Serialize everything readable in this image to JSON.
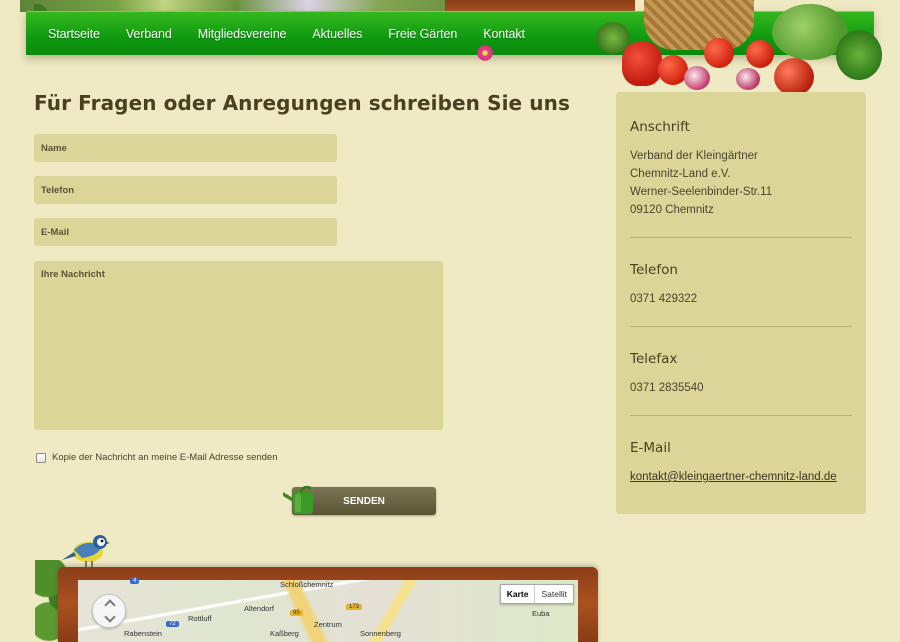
{
  "nav": {
    "items": [
      "Startseite",
      "Verband",
      "Mitgliedsvereine",
      "Aktuelles",
      "Freie Gärten",
      "Kontakt"
    ]
  },
  "form": {
    "heading": "Für Fragen oder Anregungen schreiben Sie uns",
    "name_placeholder": "Name",
    "phone_placeholder": "Telefon",
    "email_placeholder": "E-Mail",
    "message_placeholder": "Ihre Nachricht",
    "copy_label": "Kopie der Nachricht an meine E-Mail Adresse senden",
    "copy_checked": false,
    "send_label": "SENDEN"
  },
  "sidebar": {
    "address_title": "Anschrift",
    "address_lines": [
      "Verband der Kleingärtner",
      "Chemnitz-Land e.V.",
      "Werner-Seelenbinder-Str.11",
      "09120 Chemnitz"
    ],
    "phone_title": "Telefon",
    "phone": "0371 429322",
    "fax_title": "Telefax",
    "fax": "0371 2835540",
    "email_title": "E-Mail",
    "email": "kontakt@kleingaertner-chemnitz-land.de"
  },
  "map": {
    "type_map": "Karte",
    "type_satellite": "Satellit",
    "labels": [
      "Schloßchemnitz",
      "Altendorf",
      "Rottluff",
      "Zentrum",
      "Kaßberg",
      "Sonnenberg",
      "Rabenstein",
      "Euba"
    ],
    "road_numbers": [
      "95",
      "173",
      "72",
      "4"
    ]
  },
  "colors": {
    "nav_green": "#0e9a10",
    "field_bg": "#dbd698",
    "page_bg": "#efe9c4",
    "button_bg": "#5a5437"
  }
}
